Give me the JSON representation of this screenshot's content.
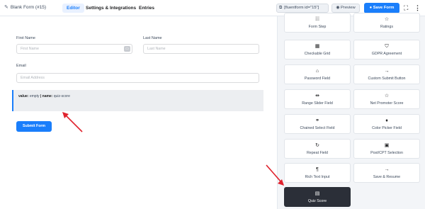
{
  "header": {
    "form_title": "Blank Form (#15)",
    "tabs": [
      {
        "label": "Editor",
        "active": true
      },
      {
        "label": "Settings & Integrations",
        "active": false
      },
      {
        "label": "Entries",
        "active": false
      }
    ],
    "shortcode": "[fluentform id=\"15\"]",
    "preview_label": "Preview",
    "save_label": "Save Form"
  },
  "form": {
    "first_name_label": "First Name",
    "first_name_placeholder": "First Name",
    "last_name_label": "Last Name",
    "last_name_placeholder": "Last Name",
    "email_label": "Email",
    "email_placeholder": "Email Address",
    "quiz_value_key": "value:",
    "quiz_value": "empty",
    "quiz_sep": "|",
    "quiz_name_key": "name:",
    "quiz_name": "quiz-score",
    "submit_label": "Submit Form"
  },
  "sidebar": {
    "fields": [
      {
        "label": "Form Step",
        "icon": "form-step-icon",
        "glyph": "⁞⁞⁞"
      },
      {
        "label": "Ratings",
        "icon": "star-icon",
        "glyph": "☆"
      },
      {
        "label": "Checkable Grid",
        "icon": "grid-icon",
        "glyph": "▦"
      },
      {
        "label": "GDPR Agreement",
        "icon": "shield-icon",
        "glyph": "⛉"
      },
      {
        "label": "Password Field",
        "icon": "lock-icon",
        "glyph": "⌂"
      },
      {
        "label": "Custom Submit Button",
        "icon": "arrow-right-icon",
        "glyph": "→"
      },
      {
        "label": "Range Slider Field",
        "icon": "slider-icon",
        "glyph": "⇹"
      },
      {
        "label": "Net Promoter Score",
        "icon": "star-icon",
        "glyph": "☆"
      },
      {
        "label": "Chained Select Field",
        "icon": "link-icon",
        "glyph": "⚭"
      },
      {
        "label": "Color Picker Field",
        "icon": "color-drop-icon",
        "glyph": "♦"
      },
      {
        "label": "Repeat Field",
        "icon": "repeat-icon",
        "glyph": "↻"
      },
      {
        "label": "Post/CPT Selection",
        "icon": "post-icon",
        "glyph": "▣"
      },
      {
        "label": "Rich Text Input",
        "icon": "rich-text-icon",
        "glyph": "¶"
      },
      {
        "label": "Save & Resume",
        "icon": "arrow-right-icon",
        "glyph": "→"
      },
      {
        "label": "Quiz Score",
        "icon": "quiz-score-icon",
        "glyph": "▤"
      }
    ]
  },
  "colors": {
    "accent": "#1a7efb",
    "arrow": "#e0232e",
    "dark_card": "#2b2f38"
  }
}
